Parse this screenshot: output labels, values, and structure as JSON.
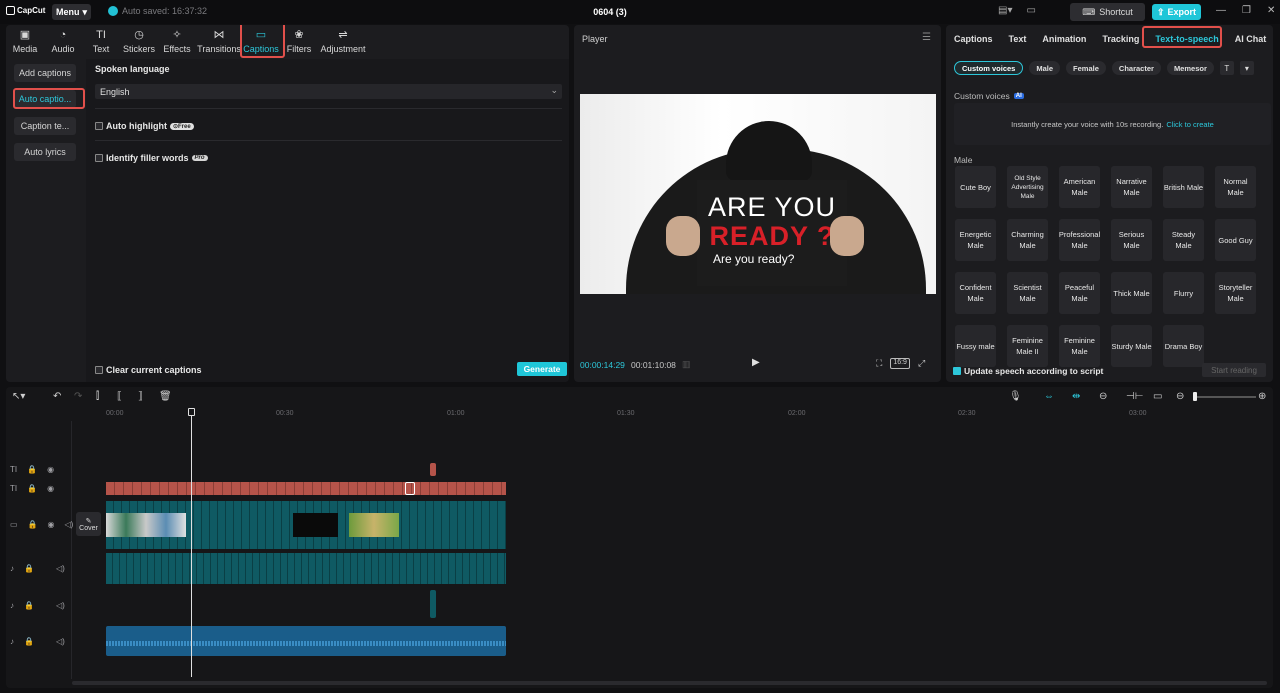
{
  "topbar": {
    "logo": "CapCut",
    "menu_label": "Menu",
    "autosave": "Auto saved: 16:37:32",
    "project_title": "0604 (3)",
    "shortcut_label": "Shortcut",
    "export_label": "Export"
  },
  "tools": [
    {
      "label": "Media",
      "icon": "media-icon"
    },
    {
      "label": "Audio",
      "icon": "audio-icon"
    },
    {
      "label": "Text",
      "icon": "text-icon"
    },
    {
      "label": "Stickers",
      "icon": "stickers-icon"
    },
    {
      "label": "Effects",
      "icon": "effects-icon"
    },
    {
      "label": "Transitions",
      "icon": "transitions-icon"
    },
    {
      "label": "Captions",
      "icon": "captions-icon",
      "active": true
    },
    {
      "label": "Filters",
      "icon": "filters-icon"
    },
    {
      "label": "Adjustment",
      "icon": "adjustment-icon"
    }
  ],
  "captions_side": [
    "Add captions",
    "Auto captio...",
    "Caption te...",
    "Auto lyrics"
  ],
  "captions_panel": {
    "spoken_language_label": "Spoken language",
    "language_value": "English",
    "auto_highlight": "Auto highlight",
    "free_badge": "Free",
    "identify_filler": "Identify filler words",
    "pro_badge": "Pro",
    "clear_captions": "Clear current captions",
    "generate": "Generate"
  },
  "player": {
    "title": "Player",
    "sign_line1": "ARE YOU",
    "sign_line2": "READY ?",
    "sign_line3": "Are you ready?",
    "current_time": "00:00:14:29",
    "total_time": "00:01:10:08",
    "ratio": "16:9"
  },
  "right_tabs": [
    "Captions",
    "Text",
    "Animation",
    "Tracking",
    "Text-to-speech",
    "AI Chat"
  ],
  "voice_filters": [
    "Custom voices",
    "Male",
    "Female",
    "Character",
    "Memesor"
  ],
  "custom_voices": {
    "label": "Custom voices",
    "ai_badge": "AI",
    "prompt": "Instantly create your voice with 10s recording.",
    "link": "Click to create"
  },
  "male_section_label": "Male",
  "voices": [
    "Cute Boy",
    "Old Style Advertising Male",
    "American Male",
    "Narrative Male",
    "British Male",
    "Normal Male",
    "Energetic Male",
    "Charming Male",
    "Professional Male",
    "Serious Male",
    "Steady Male",
    "Good Guy",
    "Confident Male",
    "Scientist Male",
    "Peaceful Male",
    "Thick Male",
    "Flurry",
    "Storyteller Male",
    "Fussy male",
    "Feminine Male II",
    "Feminine Male",
    "Sturdy Male",
    "Drama Boy"
  ],
  "tts_footer": {
    "update_label": "Update speech according to script",
    "start_reading": "Start reading"
  },
  "timeline": {
    "ruler": [
      "00:00",
      "00:30",
      "01:00",
      "01:30",
      "02:00",
      "02:30",
      "03:00"
    ],
    "cover_label": "Cover"
  },
  "colors": {
    "accent": "#1fc6d8",
    "highlight": "#e1504b",
    "caption_clip": "#b5544a",
    "video_clip": "#0f5a63",
    "audio_clip": "#1a5d8a"
  }
}
